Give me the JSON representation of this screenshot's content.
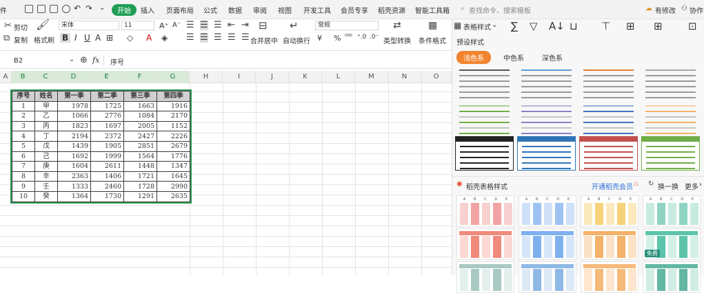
{
  "menubar": {
    "file": "件",
    "items": [
      "开始",
      "插入",
      "页面布局",
      "公式",
      "数据",
      "审阅",
      "视图",
      "开发工具",
      "会员专享",
      "稻壳资源",
      "智能工具箱"
    ],
    "search_placeholder": "查找命令、搜索模板",
    "modified": "有修改",
    "collab": "协作"
  },
  "ribbon": {
    "cut": "剪切",
    "copy": "复制",
    "format_painter": "格式刷",
    "font_name": "宋体",
    "font_size": "11",
    "bold": "B",
    "italic": "I",
    "underline": "U",
    "merge_center": "合并居中",
    "wrap_text": "自动换行",
    "number_format": "常规",
    "type_convert": "类型转换",
    "cond_format": "条件格式",
    "table_style": "表格样式",
    "currency": "¥",
    "percent": "%"
  },
  "formula": {
    "cell_ref": "B2",
    "fx": "fx",
    "value": "序号"
  },
  "columns": [
    "A",
    "B",
    "C",
    "D",
    "E",
    "F",
    "G",
    "H",
    "I",
    "J",
    "K",
    "L",
    "M",
    "N",
    "O"
  ],
  "table": {
    "headers": [
      "序号",
      "姓名",
      "第一季",
      "第二季",
      "第三季",
      "第四季"
    ],
    "rows": [
      [
        "1",
        "甲",
        "1978",
        "1725",
        "1663",
        "1916"
      ],
      [
        "2",
        "乙",
        "1066",
        "2776",
        "1084",
        "2170"
      ],
      [
        "3",
        "丙",
        "1823",
        "1697",
        "2005",
        "1152"
      ],
      [
        "4",
        "丁",
        "2194",
        "2372",
        "2427",
        "2226"
      ],
      [
        "5",
        "戊",
        "1439",
        "1905",
        "2851",
        "2679"
      ],
      [
        "6",
        "己",
        "1692",
        "1999",
        "1564",
        "1776"
      ],
      [
        "7",
        "庚",
        "1604",
        "2611",
        "1448",
        "1347"
      ],
      [
        "8",
        "辛",
        "2363",
        "1406",
        "1721",
        "1645"
      ],
      [
        "9",
        "壬",
        "1333",
        "2460",
        "1728",
        "2990"
      ],
      [
        "10",
        "癸",
        "1364",
        "1730",
        "1291",
        "2635"
      ]
    ]
  },
  "pane": {
    "title": "预设样式",
    "tabs": [
      "浅色系",
      "中色系",
      "深色系"
    ],
    "daoke_title": "稻壳表格样式",
    "open_member": "开通稻壳会员",
    "refresh": "换一换",
    "more": "更多",
    "free_badge": "免费",
    "preview_letters": [
      "A",
      "B",
      "C",
      "D",
      "E"
    ]
  },
  "colors": {
    "accent_green": "#1f9d55",
    "selection_green": "#2e9b56",
    "tab_orange": "#f2842f",
    "link_blue": "#2a6fdb"
  }
}
